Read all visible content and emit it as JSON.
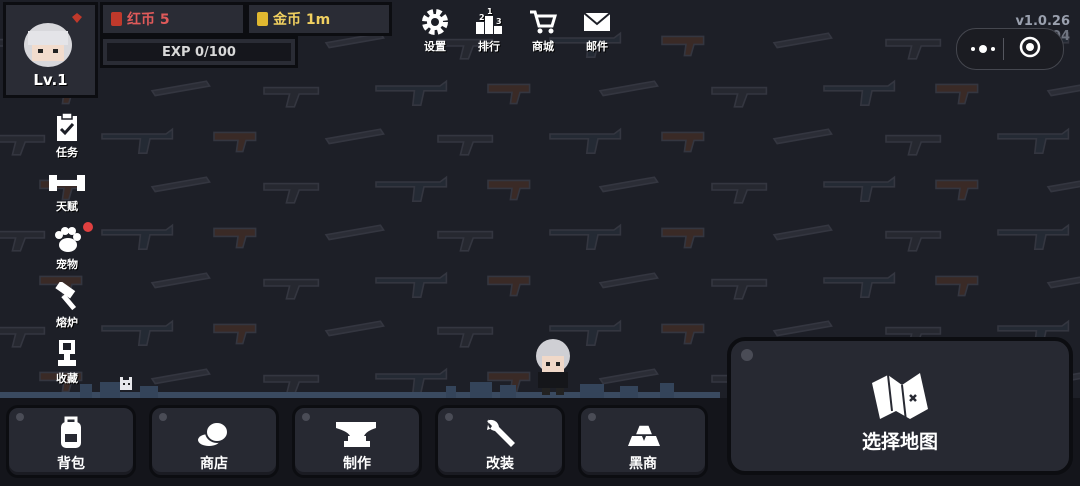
{
  "player": {
    "level": "Lv.1",
    "red_coins": "红币 5",
    "gold_coins": "金币 1m",
    "exp": "EXP 0/100"
  },
  "top_menu": [
    {
      "label": "设置",
      "icon": "gear-icon"
    },
    {
      "label": "排行",
      "icon": "podium-icon"
    },
    {
      "label": "商城",
      "icon": "cart-icon"
    },
    {
      "label": "邮件",
      "icon": "mail-icon"
    }
  ],
  "version": "v1.0.26",
  "version_sub": "S:04",
  "side_menu": [
    {
      "label": "任务",
      "icon": "clipboard-check-icon"
    },
    {
      "label": "天赋",
      "icon": "dumbbell-icon"
    },
    {
      "label": "宠物",
      "icon": "paw-icon"
    },
    {
      "label": "熔炉",
      "icon": "hammer-icon"
    },
    {
      "label": "收藏",
      "icon": "trophy-icon"
    }
  ],
  "bottom_menu": [
    {
      "label": "背包",
      "icon": "backpack-icon"
    },
    {
      "label": "商店",
      "icon": "coins-icon"
    },
    {
      "label": "制作",
      "icon": "anvil-icon"
    },
    {
      "label": "改装",
      "icon": "wrench-icon"
    },
    {
      "label": "黑商",
      "icon": "gold-bars-icon"
    }
  ],
  "map_button": {
    "label": "选择地图",
    "icon": "map-icon"
  },
  "colors": {
    "background": "#1d1f27",
    "panel": "#272932",
    "red_coin": "#e05a5a",
    "gold_coin": "#f0d060",
    "notify_dot": "#e04040"
  }
}
